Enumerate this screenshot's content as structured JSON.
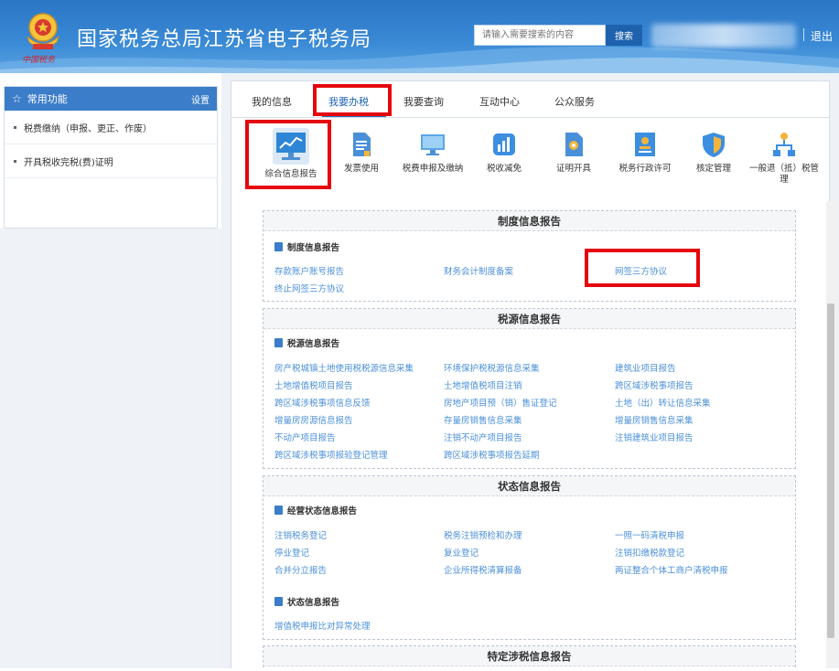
{
  "header": {
    "site_title": "国家税务总局江苏省电子税务局",
    "brand_signature": "中国税务",
    "search_placeholder": "请输入需要搜索的内容",
    "search_button": "搜索",
    "logout": "退出"
  },
  "sidebar": {
    "title": "常用功能",
    "settings": "设置",
    "items": [
      {
        "label": "税费缴纳（申报、更正、作废）"
      },
      {
        "label": "开具税收完税(费)证明"
      }
    ]
  },
  "tabs": [
    {
      "label": "我的信息",
      "active": false
    },
    {
      "label": "我要办税",
      "active": true
    },
    {
      "label": "我要查询",
      "active": false
    },
    {
      "label": "互动中心",
      "active": false
    },
    {
      "label": "公众服务",
      "active": false
    }
  ],
  "function_icons": [
    {
      "label": "综合信息报告",
      "icon": "monitor-chart-icon",
      "active": true
    },
    {
      "label": "发票使用",
      "icon": "document-icon",
      "active": false
    },
    {
      "label": "税费申报及缴纳",
      "icon": "monitor-icon",
      "active": false
    },
    {
      "label": "税收减免",
      "icon": "bar-chart-icon",
      "active": false
    },
    {
      "label": "证明开具",
      "icon": "certificate-icon",
      "active": false
    },
    {
      "label": "税务行政许可",
      "icon": "id-card-icon",
      "active": false
    },
    {
      "label": "核定管理",
      "icon": "shield-icon",
      "active": false
    },
    {
      "label": "一般退（抵）税管理",
      "icon": "hierarchy-icon",
      "active": false
    }
  ],
  "sections": {
    "institution": {
      "title": "制度信息报告",
      "sub_title": "制度信息报告",
      "links": [
        "存款账户账号报告",
        "财务会计制度备案",
        "网签三方协议",
        "终止网签三方协议"
      ]
    },
    "tax_source": {
      "title": "税源信息报告",
      "sub_title": "税源信息报告",
      "links": [
        "房产税城镇土地使用税税源信息采集",
        "环境保护税税源信息采集",
        "建筑业项目报告",
        "土地增值税项目报告",
        "土地增值税项目注销",
        "跨区域涉税事项报告",
        "跨区域涉税事项信息反馈",
        "房地产项目预（销）售证登记",
        "土地（出）转让信息采集",
        "增量房房源信息报告",
        "存量房销售信息采集",
        "增量房销售信息采集",
        "不动产项目报告",
        "注销不动产项目报告",
        "注销建筑业项目报告",
        "跨区域涉税事项报验登记管理",
        "跨区域涉税事项报告延期"
      ]
    },
    "status": {
      "title": "状态信息报告",
      "sub_title_1": "经营状态信息报告",
      "links_1": [
        "注销税务登记",
        "税务注销预检和办理",
        "一照一码清税申报",
        "停业登记",
        "复业登记",
        "注销扣缴税款登记",
        "合并分立报告",
        "企业所得税清算报备",
        "两证整合个体工商户清税申报"
      ],
      "sub_title_2": "状态信息报告",
      "links_2": [
        "增值税申报比对异常处理"
      ]
    },
    "special": {
      "title": "特定涉税信息报告"
    }
  },
  "colors": {
    "header_blue": "#2b76c5",
    "link_blue": "#4a8fd8",
    "highlight_red": "#e5050d",
    "sidebar_head": "#3b7dc8"
  }
}
